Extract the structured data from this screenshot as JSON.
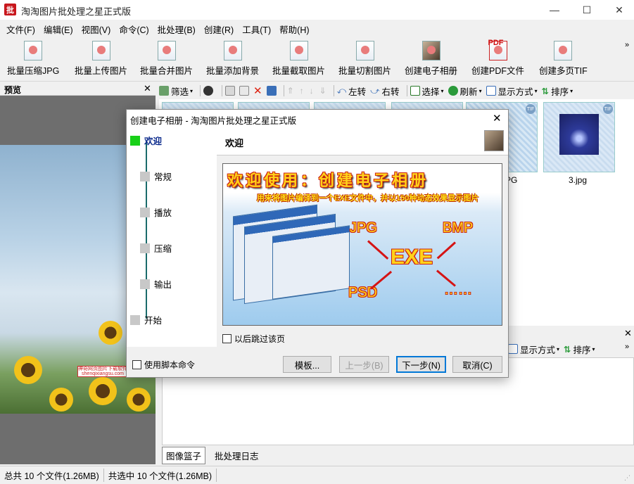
{
  "window": {
    "icon_text": "批",
    "title": "淘淘图片批处理之星正式版",
    "min_glyph": "—",
    "max_glyph": "☐",
    "close_glyph": "✕"
  },
  "menu": [
    "文件(F)",
    "编辑(E)",
    "视图(V)",
    "命令(C)",
    "批处理(B)",
    "创建(R)",
    "工具(T)",
    "帮助(H)"
  ],
  "toolbar": {
    "buttons": [
      "批量压缩JPG",
      "批量上传图片",
      "批量合并图片",
      "批量添加背景",
      "批量截取图片",
      "批量切割图片",
      "创建电子相册",
      "创建PDF文件",
      "创建多页TIF"
    ],
    "pdf_badge": "PDF",
    "more": "»"
  },
  "preview": {
    "title": "预览",
    "close": "✕",
    "watermark": "神奇网页图片下载软件 shenqixiangsu.com"
  },
  "file_toolbar": {
    "filter": "筛选",
    "rotate_left": "左转",
    "rotate_right": "右转",
    "select": "选择",
    "refresh": "刷新",
    "view_mode": "显示方式",
    "sort": "排序",
    "more": "»"
  },
  "thumbnails": {
    "labels": [
      "PG",
      "3.jpg"
    ],
    "badge": "TIF"
  },
  "lower_pane": {
    "close": "✕",
    "view_mode": "显示方式",
    "sort": "排序",
    "more": "»",
    "tabs": [
      "图像篮子",
      "批处理日志"
    ]
  },
  "status": {
    "total": "总共 10 个文件(1.26MB)",
    "selected": "共选中 10 个文件(1.26MB)",
    "grip": "⋰"
  },
  "dialog": {
    "title": "创建电子相册 - 淘淘图片批处理之星正式版",
    "close": "✕",
    "steps": [
      "欢迎",
      "常规",
      "播放",
      "压缩",
      "输出",
      "开始"
    ],
    "heading": "欢迎",
    "banner": {
      "title": "欢迎使用：创建电子相册",
      "subtitle": "用来将图片编译到一个EXE文件中，并以150种动态效果显示图片",
      "formats": [
        "JPG",
        "BMP",
        "EXE",
        "PSD",
        "……"
      ]
    },
    "skip_label": "以后跳过该页",
    "script_label": "使用脚本命令",
    "buttons": {
      "template": "模板...",
      "prev": "上一步(B)",
      "next": "下一步(N)",
      "cancel": "取消(C)"
    }
  }
}
